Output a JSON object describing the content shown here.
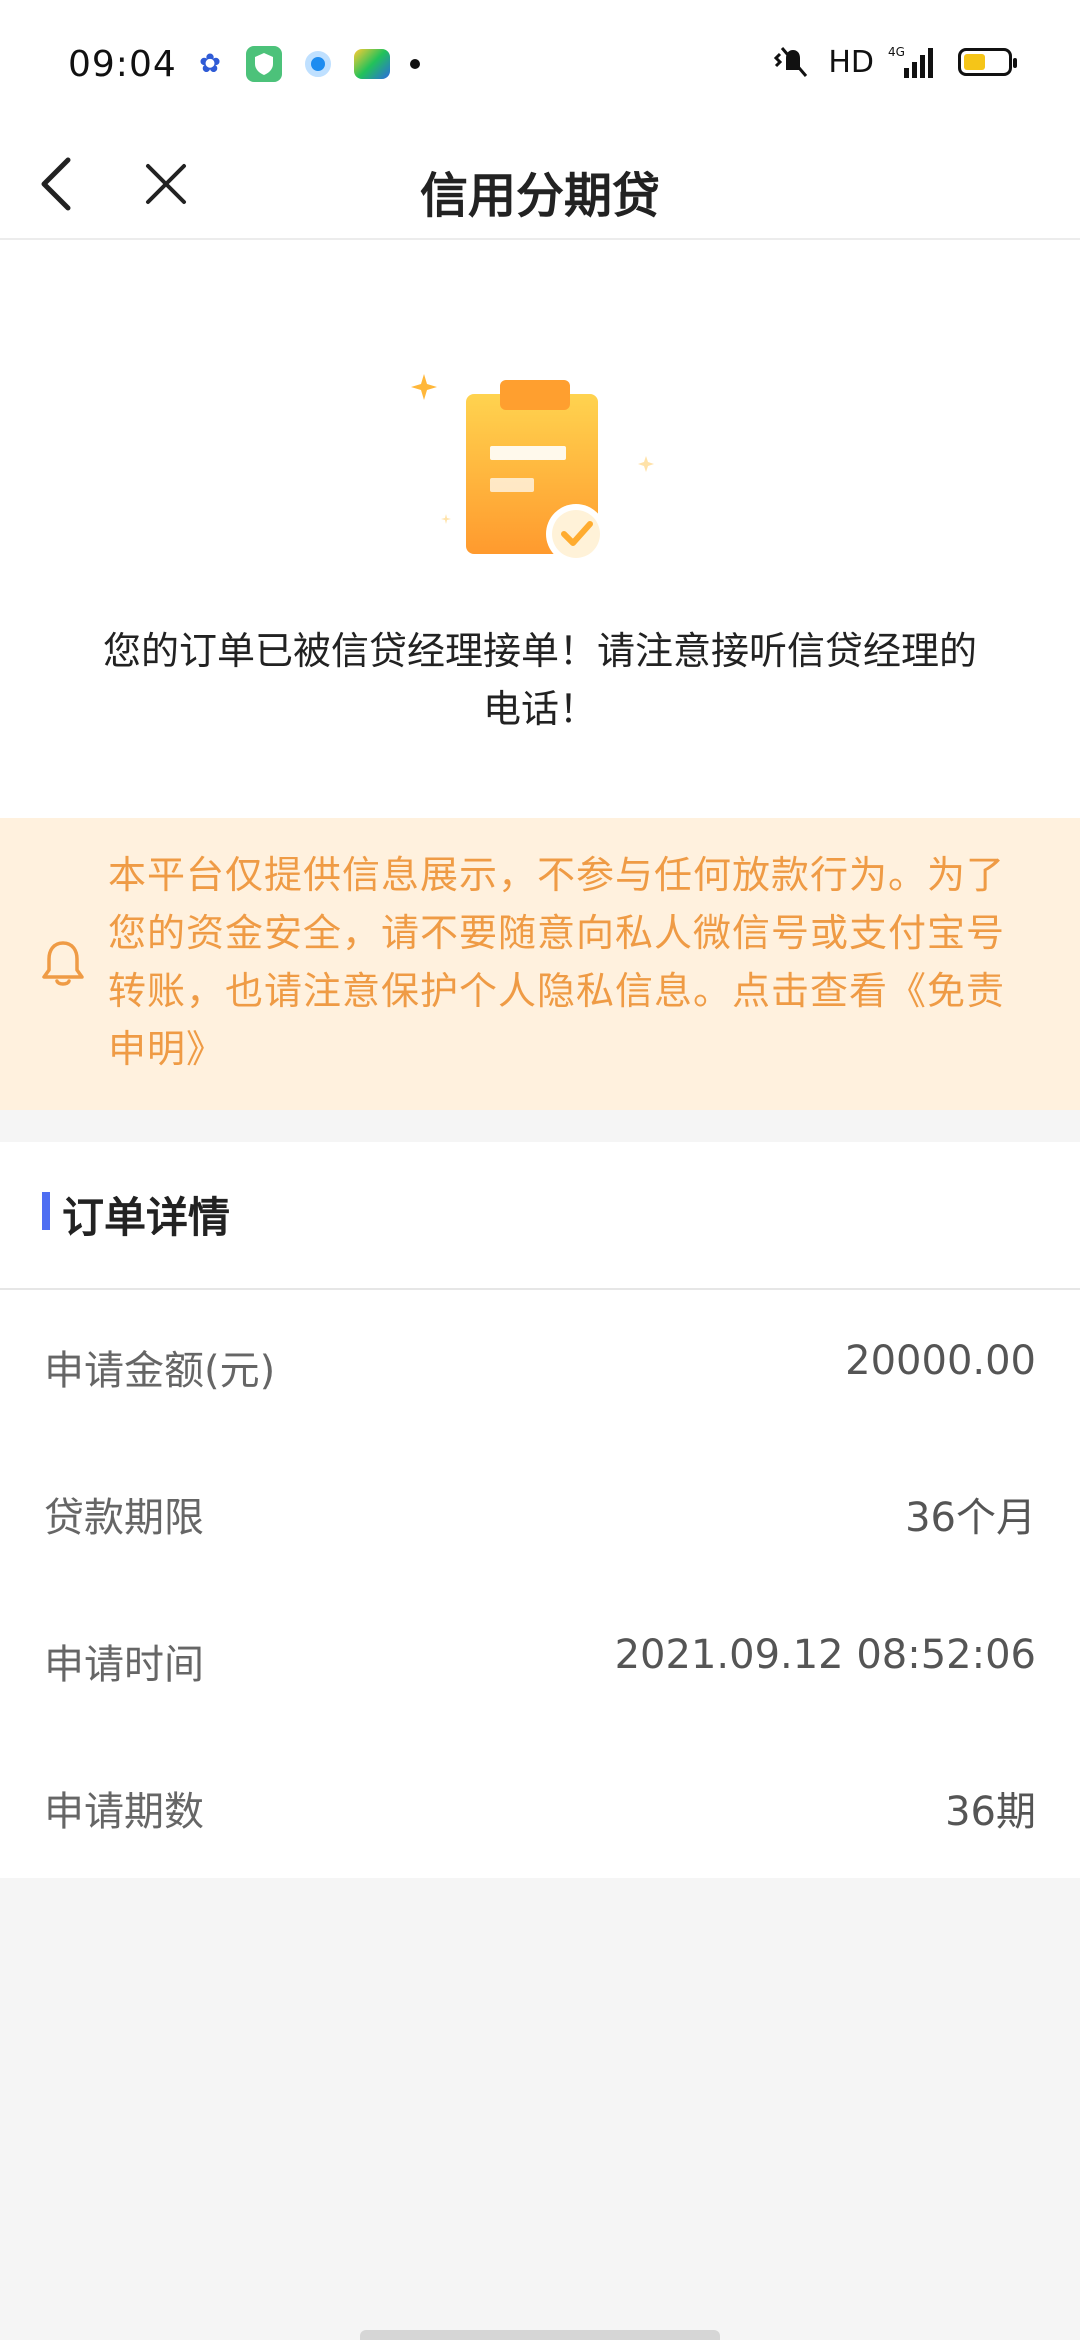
{
  "status_bar": {
    "time": "09:04",
    "network_label": "HD",
    "network_type": "4G",
    "battery_level": 0.5,
    "app_icons": [
      "baidu-icon",
      "security-shield-icon",
      "circle-app-icon",
      "video-app-icon"
    ]
  },
  "nav": {
    "title": "信用分期贷",
    "back_icon": "chevron-left-icon",
    "close_icon": "close-icon"
  },
  "success": {
    "icon": "clipboard-check-icon",
    "message_line1": "您的订单已被信贷经理接单！请注意接听信贷经理的",
    "message_line2": "电话！"
  },
  "notice": {
    "icon": "bell-icon",
    "text": "本平台仅提供信息展示，不参与任何放款行为。为了您的资金安全，请不要随意向私人微信号或支付宝号转账，也请注意保护个人隐私信息。点击查看《免责申明》",
    "color": "#ef9b45",
    "background": "#fff1de"
  },
  "details": {
    "title": "订单详情",
    "accent_color": "#4e6ef2",
    "rows": [
      {
        "label": "申请金额(元)",
        "value": "20000.00"
      },
      {
        "label": "贷款期限",
        "value": "36个月"
      },
      {
        "label": "申请时间",
        "value": "2021.09.12 08:52:06"
      },
      {
        "label": "申请期数",
        "value": "36期"
      }
    ]
  }
}
